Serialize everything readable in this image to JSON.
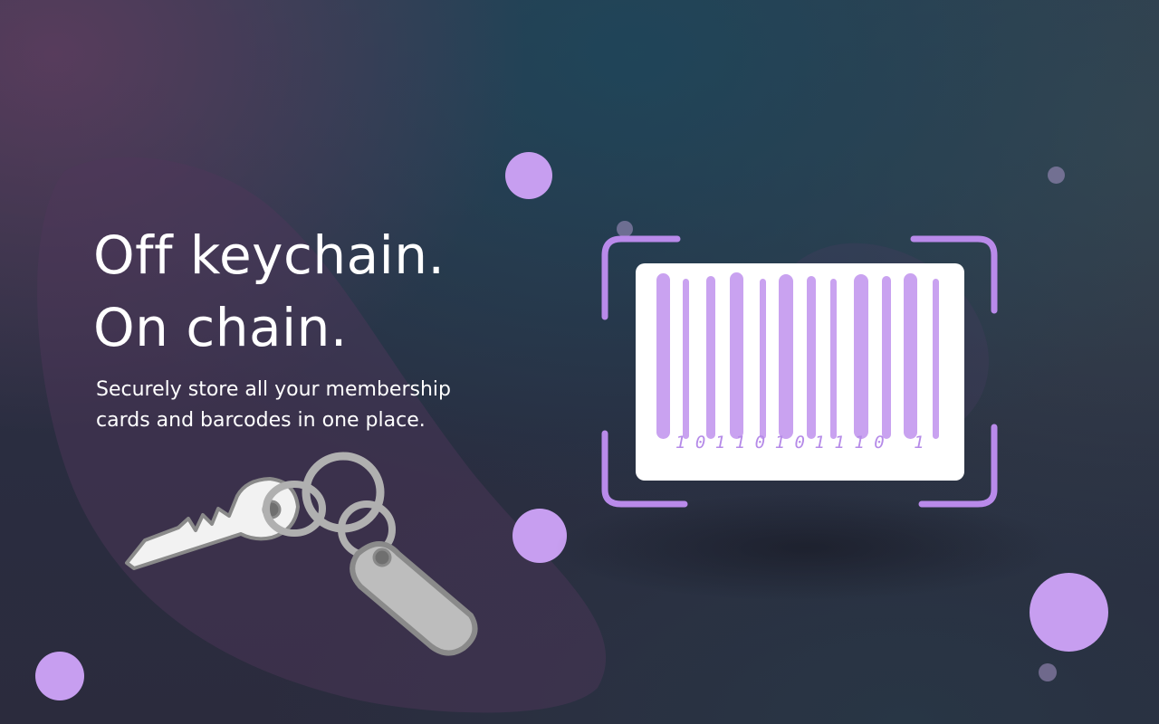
{
  "hero": {
    "headline_line1": "Off keychain.",
    "headline_line2": "On chain.",
    "subtitle_line1": "Securely store all your membership",
    "subtitle_line2": "cards and barcodes in one place."
  },
  "barcode": {
    "digits": "10110101110 1"
  },
  "colors": {
    "accent": "#c79ef0",
    "bar": "#c9a2f0",
    "frame": "#b98aea",
    "text": "#ffffff",
    "card": "#ffffff",
    "key_fill": "#f2f2f2",
    "key_stroke": "#8a8a8a"
  },
  "icons": {
    "keychain": "keychain-illustration",
    "barcode": "barcode-illustration",
    "scan_frame": "scan-frame-corners"
  }
}
